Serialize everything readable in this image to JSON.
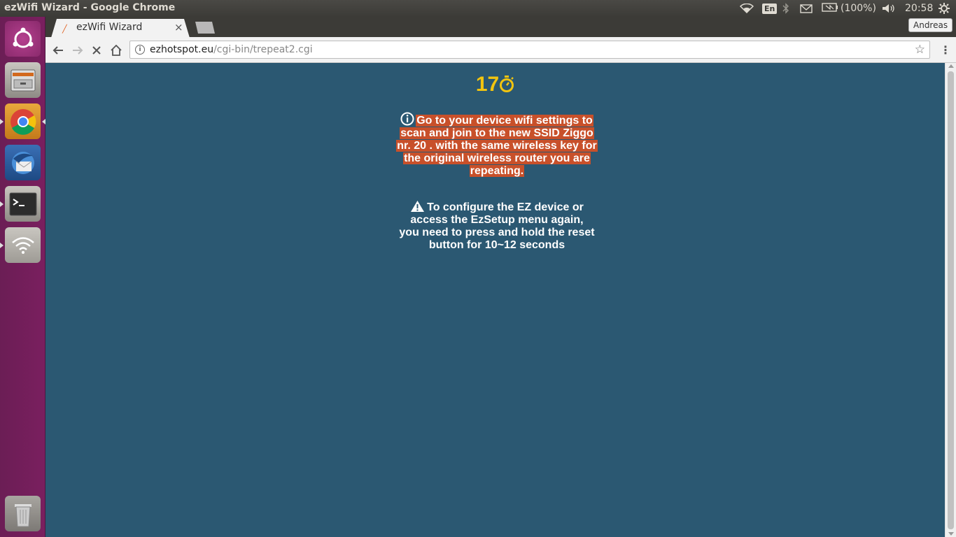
{
  "window": {
    "title": "ezWifi Wizard - Google Chrome"
  },
  "tray": {
    "lang": "En",
    "battery": "(100%)",
    "clock": "20:58"
  },
  "browser": {
    "tab_title": "ezWifi Wizard",
    "tab_close": "×",
    "profile": "Andreas",
    "url_host": "ezhotspot.eu",
    "url_path": "/cgi-bin/trepeat2.cgi"
  },
  "page": {
    "countdown": "17",
    "info_message": "Go to your device wifi settings to scan and join to the new SSID Ziggo nr. 20 . with the same wireless key for the original wireless router you are repeating.",
    "warning_message": "To configure the EZ device or access the EzSetup menu again, you need to press and hold the reset button for 10~12 seconds"
  },
  "colors": {
    "page_bg": "#2b5872",
    "countdown": "#f2c40f",
    "info_highlight": "#c8502a",
    "launcher": "#7a1f5f"
  },
  "icons": [
    "timer-icon",
    "info-circle-icon",
    "warning-icon",
    "wifi-icon",
    "bluetooth-icon",
    "mail-icon",
    "battery-icon",
    "volume-icon",
    "settings-gear-icon"
  ]
}
